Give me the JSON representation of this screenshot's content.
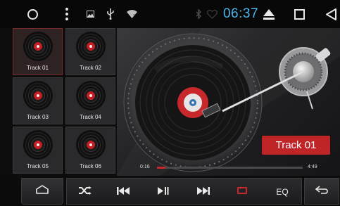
{
  "status_bar": {
    "clock": "06:37",
    "icons": [
      "circle-icon",
      "menu-dots-icon",
      "image-icon",
      "usb-icon",
      "wifi-icon",
      "bluetooth-icon",
      "heart-icon",
      "eject-icon",
      "square-icon",
      "back-triangle-icon"
    ],
    "clock_color": "#4db5ea"
  },
  "tracks": [
    {
      "label": "Track 01"
    },
    {
      "label": "Track 02"
    },
    {
      "label": "Track 03"
    },
    {
      "label": "Track 04"
    },
    {
      "label": "Track 05"
    },
    {
      "label": "Track 06"
    }
  ],
  "player": {
    "current_track": "Track 01",
    "elapsed": "0:16",
    "total": "4:49",
    "progress_fraction": 0.06,
    "accent_color": "#c8282c"
  },
  "bottom_bar": {
    "eq_label": "EQ",
    "icons": [
      "home-icon",
      "shuffle-icon",
      "previous-icon",
      "play-pause-icon",
      "next-icon",
      "repeat-icon",
      "back-arrow-icon"
    ]
  }
}
